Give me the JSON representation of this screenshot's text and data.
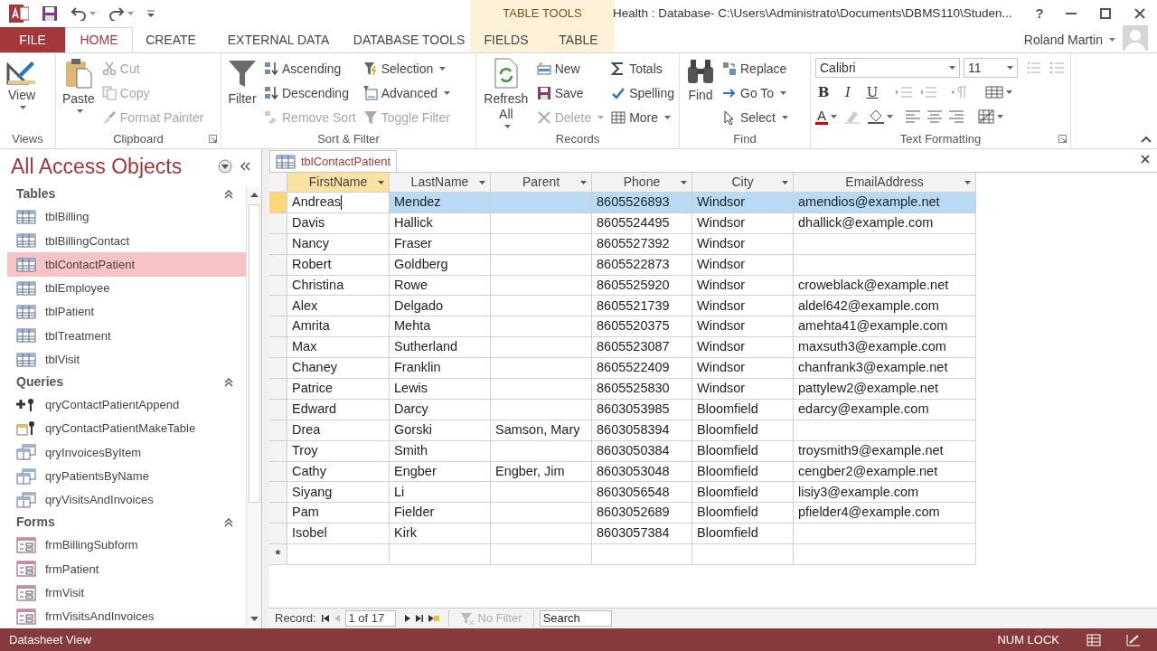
{
  "window": {
    "title": "Health : Database- C:\\Users\\Administrato\\Documents\\DBMS110\\Studen...",
    "help": "?"
  },
  "ribbon_tabs": [
    {
      "label": "FILE",
      "kind": "file",
      "selected": false
    },
    {
      "label": "HOME",
      "kind": "normal",
      "selected": true
    },
    {
      "label": "CREATE",
      "kind": "normal",
      "selected": false
    },
    {
      "label": "EXTERNAL DATA",
      "kind": "normal",
      "selected": false
    },
    {
      "label": "DATABASE TOOLS",
      "kind": "normal",
      "selected": false
    }
  ],
  "contextual_tabs": {
    "label": "TABLE TOOLS",
    "tabs": [
      {
        "label": "FIELDS",
        "selected": false
      },
      {
        "label": "TABLE",
        "selected": false
      }
    ]
  },
  "user": {
    "name": "Roland Martin"
  },
  "ribbon_groups": [
    {
      "kind": "buttons",
      "label": "Views",
      "launcher": false,
      "items": [
        {
          "label": "View",
          "kind": "large",
          "dropdown": true,
          "disabled": false
        }
      ]
    },
    {
      "kind": "buttons",
      "label": "Clipboard",
      "launcher": true,
      "items": [
        {
          "label": "Paste",
          "kind": "large",
          "dropdown": true,
          "disabled": false
        },
        {
          "label": "Cut",
          "kind": "small",
          "dropdown": false,
          "disabled": true
        },
        {
          "label": "Copy",
          "kind": "small",
          "dropdown": false,
          "disabled": true
        },
        {
          "label": "Format Painter",
          "kind": "small",
          "dropdown": false,
          "disabled": true
        }
      ]
    },
    {
      "kind": "buttons",
      "label": "Sort & Filter",
      "launcher": false,
      "items": [
        {
          "label": "Filter",
          "kind": "large",
          "dropdown": false,
          "disabled": false
        },
        {
          "label": "Ascending",
          "kind": "small",
          "dropdown": false,
          "disabled": false
        },
        {
          "label": "Descending",
          "kind": "small",
          "dropdown": false,
          "disabled": false
        },
        {
          "label": "Remove Sort",
          "kind": "small",
          "dropdown": false,
          "disabled": true
        },
        {
          "label": "Selection",
          "kind": "small",
          "dropdown": true,
          "disabled": false
        },
        {
          "label": "Advanced",
          "kind": "small",
          "dropdown": true,
          "disabled": false
        },
        {
          "label": "Toggle Filter",
          "kind": "small",
          "dropdown": false,
          "disabled": true
        }
      ]
    },
    {
      "kind": "buttons",
      "label": "Records",
      "launcher": false,
      "items": [
        {
          "label": "Refresh All",
          "kind": "large",
          "dropdown": true,
          "disabled": false
        },
        {
          "label": "New",
          "kind": "small",
          "dropdown": false,
          "disabled": false
        },
        {
          "label": "Save",
          "kind": "small",
          "dropdown": false,
          "disabled": false
        },
        {
          "label": "Delete",
          "kind": "small",
          "dropdown": true,
          "disabled": true
        },
        {
          "label": "Totals",
          "kind": "small",
          "dropdown": false,
          "disabled": false
        },
        {
          "label": "Spelling",
          "kind": "small",
          "dropdown": false,
          "disabled": false
        },
        {
          "label": "More",
          "kind": "small",
          "dropdown": true,
          "disabled": false
        }
      ]
    },
    {
      "kind": "buttons",
      "label": "Find",
      "launcher": false,
      "items": [
        {
          "label": "Find",
          "kind": "large",
          "dropdown": false,
          "disabled": false
        },
        {
          "label": "Replace",
          "kind": "small",
          "dropdown": false,
          "disabled": false
        },
        {
          "label": "Go To",
          "kind": "small",
          "dropdown": true,
          "disabled": false
        },
        {
          "label": "Select",
          "kind": "small",
          "dropdown": true,
          "disabled": false
        }
      ]
    },
    {
      "kind": "text_formatting",
      "label": "Text Formatting",
      "launcher": true,
      "font": "Calibri",
      "size": "11",
      "styles": [
        "B",
        "I",
        "U"
      ],
      "font_color": "A"
    }
  ],
  "nav_pane": {
    "title": "All Access Objects",
    "groups": [
      {
        "label": "Tables",
        "items": [
          {
            "label": "tblBilling",
            "kind": "table",
            "selected": false
          },
          {
            "label": "tblBillingContact",
            "kind": "table",
            "selected": false
          },
          {
            "label": "tblContactPatient",
            "kind": "table",
            "selected": true
          },
          {
            "label": "tblEmployee",
            "kind": "table",
            "selected": false
          },
          {
            "label": "tblPatient",
            "kind": "table",
            "selected": false
          },
          {
            "label": "tblTreatment",
            "kind": "table",
            "selected": false
          },
          {
            "label": "tblVisit",
            "kind": "table",
            "selected": false
          }
        ]
      },
      {
        "label": "Queries",
        "items": [
          {
            "label": "qryContactPatientAppend",
            "kind": "append_query",
            "selected": false
          },
          {
            "label": "qryContactPatientMakeTable",
            "kind": "make_table_query",
            "selected": false
          },
          {
            "label": "qryInvoicesByItem",
            "kind": "select_query",
            "selected": false
          },
          {
            "label": "qryPatientsByName",
            "kind": "select_query",
            "selected": false
          },
          {
            "label": "qryVisitsAndInvoices",
            "kind": "select_query",
            "selected": false
          }
        ]
      },
      {
        "label": "Forms",
        "items": [
          {
            "label": "frmBillingSubform",
            "kind": "form",
            "selected": false
          },
          {
            "label": "frmPatient",
            "kind": "form",
            "selected": false
          },
          {
            "label": "frmVisit",
            "kind": "form",
            "selected": false
          },
          {
            "label": "frmVisitsAndInvoices",
            "kind": "form",
            "selected": false
          }
        ]
      }
    ]
  },
  "document_tab": {
    "label": "tblContactPatient"
  },
  "table": {
    "columns": [
      {
        "label": "FirstName",
        "selected": true
      },
      {
        "label": "LastName",
        "selected": false
      },
      {
        "label": "Parent",
        "selected": false
      },
      {
        "label": "Phone",
        "selected": false
      },
      {
        "label": "City",
        "selected": false
      },
      {
        "label": "EmailAddress",
        "selected": false
      }
    ],
    "rows": [
      {
        "selected": true,
        "cells": [
          "Andreas",
          "Mendez",
          null,
          "8605526893",
          "Windsor",
          "amendios@example.net"
        ]
      },
      {
        "selected": false,
        "cells": [
          "Davis",
          "Hallick",
          null,
          "8605524495",
          "Windsor",
          "dhallick@example.com"
        ]
      },
      {
        "selected": false,
        "cells": [
          "Nancy",
          "Fraser",
          null,
          "8605527392",
          "Windsor",
          null
        ]
      },
      {
        "selected": false,
        "cells": [
          "Robert",
          "Goldberg",
          null,
          "8605522873",
          "Windsor",
          null
        ]
      },
      {
        "selected": false,
        "cells": [
          "Christina",
          "Rowe",
          null,
          "8605525920",
          "Windsor",
          "croweblack@example.net"
        ]
      },
      {
        "selected": false,
        "cells": [
          "Alex",
          "Delgado",
          null,
          "8605521739",
          "Windsor",
          "aldel642@example.com"
        ]
      },
      {
        "selected": false,
        "cells": [
          "Amrita",
          "Mehta",
          null,
          "8605520375",
          "Windsor",
          "amehta41@example.com"
        ]
      },
      {
        "selected": false,
        "cells": [
          "Max",
          "Sutherland",
          null,
          "8605523087",
          "Windsor",
          "maxsuth3@example.com"
        ]
      },
      {
        "selected": false,
        "cells": [
          "Chaney",
          "Franklin",
          null,
          "8605522409",
          "Windsor",
          "chanfrank3@example.net"
        ]
      },
      {
        "selected": false,
        "cells": [
          "Patrice",
          "Lewis",
          null,
          "8605525830",
          "Windsor",
          "pattylew2@example.net"
        ]
      },
      {
        "selected": false,
        "cells": [
          "Edward",
          "Darcy",
          null,
          "8603053985",
          "Bloomfield",
          "edarcy@example.com"
        ]
      },
      {
        "selected": false,
        "cells": [
          "Drea",
          "Gorski",
          "Samson, Mary",
          "8603058394",
          "Bloomfield",
          null
        ]
      },
      {
        "selected": false,
        "cells": [
          "Troy",
          "Smith",
          null,
          "8603050384",
          "Bloomfield",
          "troysmith9@example.net"
        ]
      },
      {
        "selected": false,
        "cells": [
          "Cathy",
          "Engber",
          "Engber, Jim",
          "8603053048",
          "Bloomfield",
          "cengber2@example.net"
        ]
      },
      {
        "selected": false,
        "cells": [
          "Siyang",
          "Li",
          null,
          "8603056548",
          "Bloomfield",
          "lisiy3@example.com"
        ]
      },
      {
        "selected": false,
        "cells": [
          "Pam",
          "Fielder",
          null,
          "8603052689",
          "Bloomfield",
          "pfielder4@example.com"
        ]
      },
      {
        "selected": false,
        "cells": [
          "Isobel",
          "Kirk",
          null,
          "8603057384",
          "Bloomfield",
          null
        ]
      }
    ],
    "new_row_marker": "*"
  },
  "record_nav": {
    "label": "Record:",
    "position": "1 of 17",
    "filter": "No Filter",
    "filter_disabled": true,
    "search_placeholder": "Search"
  },
  "status_bar": {
    "view": "Datasheet View",
    "indicators": [
      "NUM LOCK"
    ]
  }
}
